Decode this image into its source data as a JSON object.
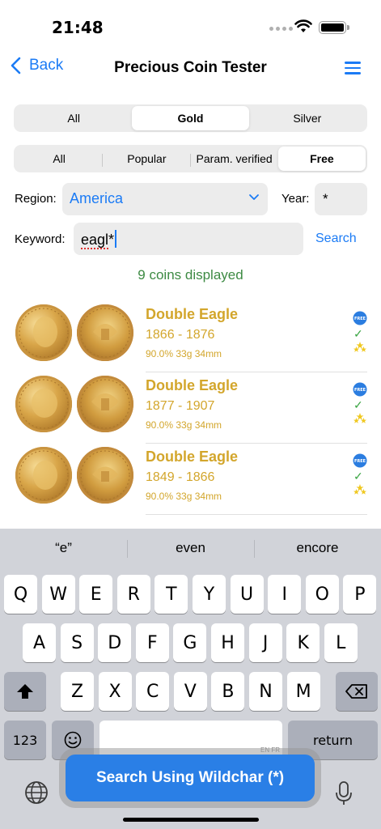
{
  "status": {
    "time": "21:48"
  },
  "nav": {
    "back_label": "Back",
    "title": "Precious Coin Tester"
  },
  "metal_tabs": [
    {
      "label": "All",
      "selected": false
    },
    {
      "label": "Gold",
      "selected": true
    },
    {
      "label": "Silver",
      "selected": false
    }
  ],
  "filter_tabs": [
    {
      "label": "All",
      "selected": false
    },
    {
      "label": "Popular",
      "selected": false
    },
    {
      "label": "Param. verified",
      "selected": false
    },
    {
      "label": "Free",
      "selected": true
    }
  ],
  "form": {
    "region_label": "Region:",
    "region_value": "America",
    "year_label": "Year:",
    "year_value": "*",
    "keyword_label": "Keyword:",
    "keyword_value": "eagl",
    "keyword_wildcard": "*",
    "search_label": "Search"
  },
  "count_text": "9 coins displayed",
  "coins": [
    {
      "name": "Double Eagle",
      "years": "1866 - 1876",
      "spec": "90.0% 33g 34mm",
      "free": true,
      "verified": true,
      "popular": true
    },
    {
      "name": "Double Eagle",
      "years": "1877 - 1907",
      "spec": "90.0% 33g 34mm",
      "free": true,
      "verified": true,
      "popular": true
    },
    {
      "name": "Double Eagle",
      "years": "1849 - 1866",
      "spec": "90.0% 33g 34mm",
      "free": true,
      "verified": true,
      "popular": true
    }
  ],
  "keyboard": {
    "suggestions": [
      "“e”",
      "even",
      "encore"
    ],
    "row1": [
      "Q",
      "W",
      "E",
      "R",
      "T",
      "Y",
      "U",
      "I",
      "O",
      "P"
    ],
    "row2": [
      "A",
      "S",
      "D",
      "F",
      "G",
      "H",
      "J",
      "K",
      "L"
    ],
    "row3": [
      "Z",
      "X",
      "C",
      "V",
      "B",
      "N",
      "M"
    ],
    "numbers_label": "123",
    "return_label": "return",
    "lang_hint": "EN FR"
  },
  "wildchar_button": "Search Using Wildchar (*)",
  "colors": {
    "accent": "#1b7bf5",
    "gold_text": "#d3a62c",
    "count_green": "#3d8a43",
    "wildchar_blue": "#2a7fe6"
  }
}
